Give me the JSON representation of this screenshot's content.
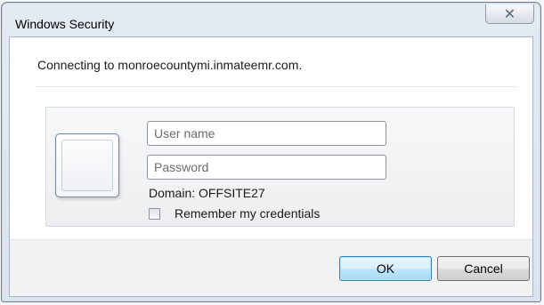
{
  "window": {
    "title": "Windows Security",
    "close_glyph": "✕"
  },
  "message": "Connecting to monroecountymi.inmateemr.com.",
  "credentials": {
    "username_placeholder": "User name",
    "username_value": "",
    "password_placeholder": "Password",
    "password_value": "",
    "domain_text": "Domain: OFFSITE27",
    "remember_label": "Remember my credentials",
    "remember_checked": false,
    "user_tile_icon": "user-tile-icon"
  },
  "buttons": {
    "ok_label": "OK",
    "cancel_label": "Cancel"
  },
  "colors": {
    "ok_button_accent": "#3c7fb1",
    "window_frame": "#dbe3ee"
  }
}
